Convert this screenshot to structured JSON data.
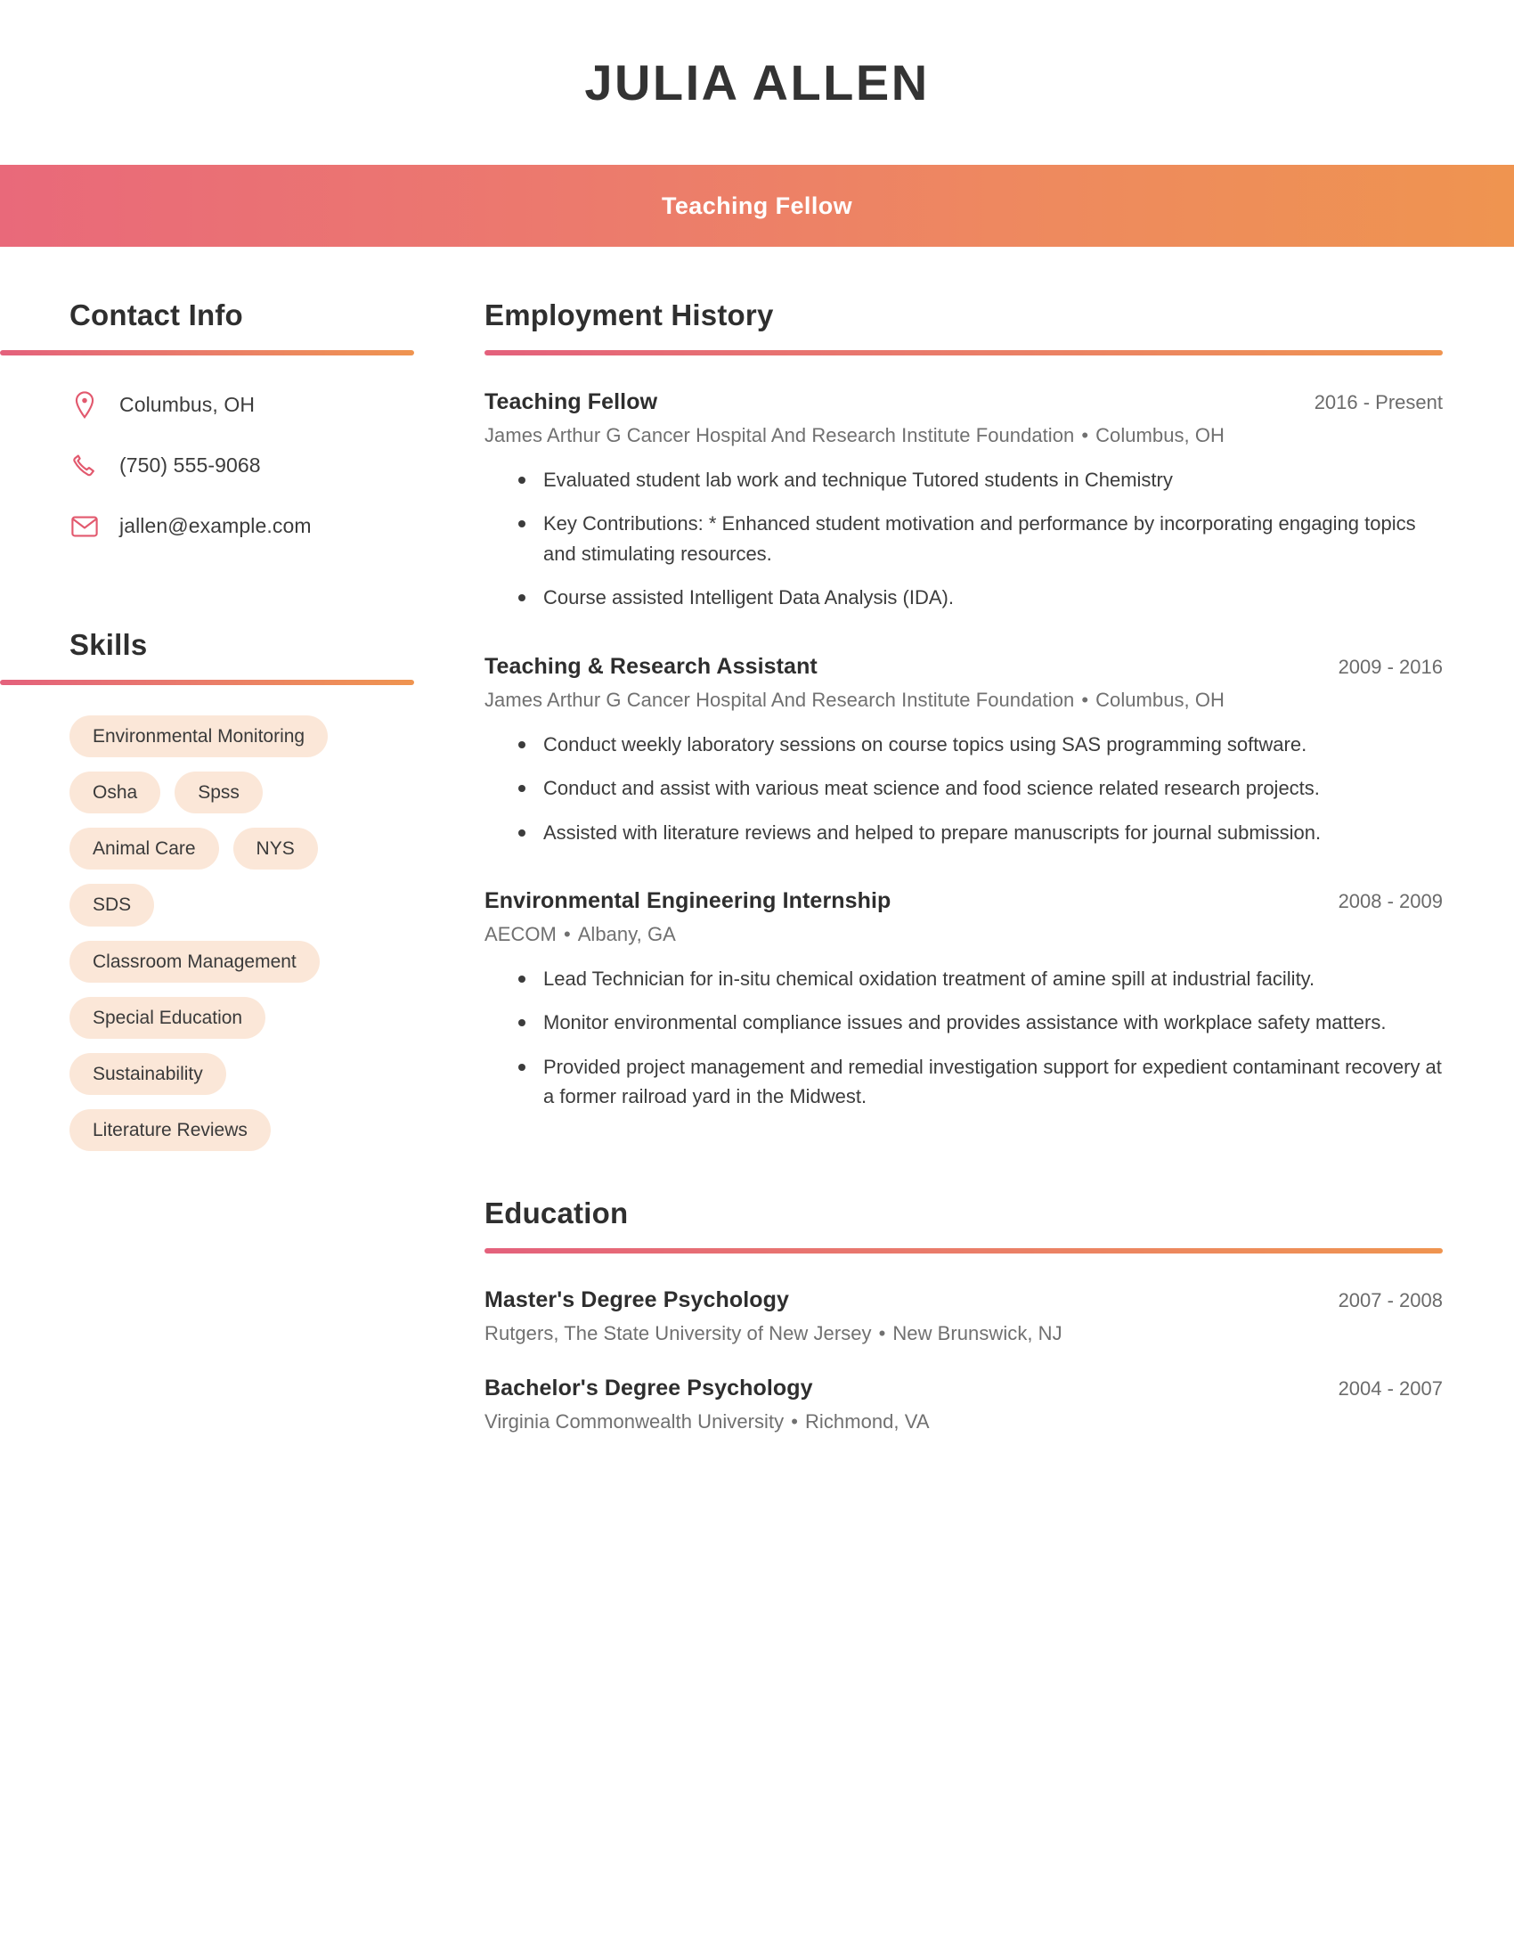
{
  "header": {
    "name": "JULIA ALLEN",
    "job_title": "Teaching Fellow",
    "gradient_start": "#e9697a",
    "gradient_end": "#ef9450"
  },
  "sidebar": {
    "contact": {
      "heading": "Contact Info",
      "items": [
        {
          "icon": "location-pin-icon",
          "value": "Columbus, OH"
        },
        {
          "icon": "phone-icon",
          "value": "(750) 555-9068"
        },
        {
          "icon": "envelope-icon",
          "value": "jallen@example.com"
        }
      ]
    },
    "skills": {
      "heading": "Skills",
      "items": [
        "Environmental Monitoring",
        "Osha",
        "Spss",
        "Animal Care",
        "NYS",
        "SDS",
        "Classroom Management",
        "Special Education",
        "Sustainability",
        "Literature Reviews"
      ]
    }
  },
  "main": {
    "employment": {
      "heading": "Employment History",
      "entries": [
        {
          "role": "Teaching Fellow",
          "dates": "2016 - Present",
          "company": "James Arthur G Cancer Hospital And Research Institute Foundation",
          "separator": "•",
          "location": "Columbus, OH",
          "bullets": [
            "Evaluated student lab work and technique Tutored students in Chemistry",
            "Key Contributions: * Enhanced student motivation and performance by incorporating engaging topics and stimulating resources.",
            "Course assisted Intelligent Data Analysis (IDA)."
          ]
        },
        {
          "role": "Teaching & Research Assistant",
          "dates": "2009 - 2016",
          "company": "James Arthur G Cancer Hospital And Research Institute Foundation",
          "separator": "•",
          "location": "Columbus, OH",
          "bullets": [
            "Conduct weekly laboratory sessions on course topics using SAS programming software.",
            "Conduct and assist with various meat science and food science related research projects.",
            "Assisted with literature reviews and helped to prepare manuscripts for journal submission."
          ]
        },
        {
          "role": "Environmental Engineering Internship",
          "dates": "2008 - 2009",
          "company": "AECOM",
          "separator": "•",
          "location": "Albany, GA",
          "bullets": [
            "Lead Technician for in-situ chemical oxidation treatment of amine spill at industrial facility.",
            "Monitor environmental compliance issues and provides assistance with workplace safety matters.",
            "Provided project management and remedial investigation support for expedient contaminant recovery at a former railroad yard in the Midwest."
          ]
        }
      ]
    },
    "education": {
      "heading": "Education",
      "entries": [
        {
          "degree": "Master's Degree Psychology",
          "dates": "2007 - 2008",
          "school": "Rutgers, The State University of New Jersey",
          "separator": "•",
          "location": "New Brunswick, NJ"
        },
        {
          "degree": "Bachelor's Degree Psychology",
          "dates": "2004 - 2007",
          "school": "Virginia Commonwealth University",
          "separator": "•",
          "location": "Richmond, VA"
        }
      ]
    }
  }
}
